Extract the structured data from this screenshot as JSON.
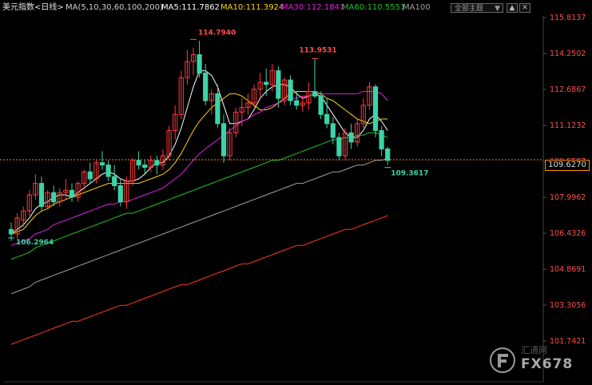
{
  "header": {
    "symbol_label": "美元指数<日线>",
    "ma_params": "MA(5,10,30,60,100,200)",
    "ma5": "MA5:111.7862",
    "ma10": "MA10:111.3924",
    "ma30": "MA30:112.1841",
    "ma60": "MA60:110.5551",
    "ma100": "MA100",
    "dropdown_label": "全部主题",
    "dropdown_arrow": "▼",
    "tool_up": "▲",
    "tool_close": "✕"
  },
  "price_axis": {
    "ticks": [
      "115.8137",
      "114.2502",
      "112.6867",
      "111.1232",
      "109.5597",
      "107.9962",
      "106.4326",
      "104.8691",
      "103.3056",
      "101.7421"
    ],
    "current_tag": "109.6270"
  },
  "annotations": {
    "high": "114.7940",
    "high2": "113.9531",
    "low": "106.2964",
    "last_low": "109.3617"
  },
  "watermark": {
    "brand": "汇通网",
    "code": "FX678"
  },
  "colors": {
    "up": "#ff3b3b",
    "down": "#3cd3a8",
    "ma5": "#ffffff",
    "ma10": "#ffd400",
    "ma30": "#e020e0",
    "ma60": "#22c322",
    "ma100": "#a0a0a0",
    "ma200": "#ff3a1a",
    "axis_text": "#ff4d4d",
    "price_line": "#ff8c00"
  },
  "chart_data": {
    "type": "candlestick",
    "title": "美元指数<日线>",
    "ylim": [
      101.7421,
      115.8137
    ],
    "current_price": 109.627,
    "candles": [
      [
        106.6,
        106.9,
        106.1,
        106.4
      ],
      [
        106.4,
        107.3,
        106.2,
        107.1
      ],
      [
        107.0,
        107.6,
        106.7,
        107.4
      ],
      [
        107.4,
        108.3,
        107.2,
        108.1
      ],
      [
        108.1,
        109.0,
        107.9,
        108.6
      ],
      [
        108.6,
        108.9,
        107.4,
        107.6
      ],
      [
        107.6,
        108.3,
        107.5,
        108.2
      ],
      [
        108.2,
        108.5,
        107.6,
        107.8
      ],
      [
        107.8,
        108.4,
        107.6,
        108.2
      ],
      [
        108.2,
        108.8,
        107.9,
        108.3
      ],
      [
        108.3,
        108.6,
        107.8,
        108.0
      ],
      [
        108.0,
        108.7,
        107.8,
        108.6
      ],
      [
        108.6,
        109.2,
        108.3,
        109.1
      ],
      [
        109.1,
        109.5,
        108.6,
        108.8
      ],
      [
        108.8,
        109.6,
        108.6,
        109.5
      ],
      [
        109.5,
        110.0,
        109.2,
        109.4
      ],
      [
        109.4,
        109.6,
        108.7,
        108.9
      ],
      [
        108.9,
        109.4,
        108.3,
        108.5
      ],
      [
        108.5,
        108.8,
        107.6,
        107.8
      ],
      [
        107.8,
        108.9,
        107.5,
        108.7
      ],
      [
        108.7,
        109.7,
        108.5,
        109.6
      ],
      [
        109.6,
        110.0,
        109.2,
        109.4
      ],
      [
        109.4,
        109.6,
        109.0,
        109.3
      ],
      [
        109.3,
        109.8,
        109.1,
        109.6
      ],
      [
        109.6,
        109.8,
        109.0,
        109.4
      ],
      [
        109.4,
        110.1,
        109.2,
        109.8
      ],
      [
        109.8,
        111.1,
        109.6,
        110.9
      ],
      [
        110.9,
        112.0,
        110.5,
        111.6
      ],
      [
        111.6,
        113.5,
        111.4,
        113.2
      ],
      [
        113.2,
        114.4,
        112.9,
        113.9
      ],
      [
        113.9,
        114.5,
        113.3,
        114.2
      ],
      [
        114.2,
        114.8,
        113.2,
        113.4
      ],
      [
        113.4,
        113.8,
        112.0,
        112.2
      ],
      [
        112.2,
        112.7,
        111.6,
        112.5
      ],
      [
        112.5,
        112.9,
        111.0,
        111.2
      ],
      [
        111.2,
        111.6,
        109.5,
        109.8
      ],
      [
        109.8,
        111.0,
        109.6,
        110.8
      ],
      [
        110.8,
        111.9,
        110.6,
        111.7
      ],
      [
        111.7,
        112.3,
        111.1,
        111.9
      ],
      [
        111.9,
        112.5,
        111.6,
        112.1
      ],
      [
        112.1,
        112.9,
        111.9,
        112.7
      ],
      [
        112.7,
        113.4,
        112.3,
        113.0
      ],
      [
        113.0,
        113.6,
        112.4,
        112.9
      ],
      [
        112.9,
        113.8,
        112.6,
        113.5
      ],
      [
        113.5,
        113.7,
        111.9,
        112.3
      ],
      [
        112.3,
        113.2,
        112.0,
        113.1
      ],
      [
        113.1,
        113.3,
        112.0,
        112.2
      ],
      [
        112.2,
        112.6,
        111.8,
        112.0
      ],
      [
        112.0,
        112.4,
        111.7,
        112.1
      ],
      [
        112.1,
        113.0,
        111.8,
        112.6
      ],
      [
        112.6,
        114.0,
        112.3,
        112.4
      ],
      [
        112.4,
        112.6,
        111.4,
        111.6
      ],
      [
        111.6,
        112.3,
        111.0,
        111.2
      ],
      [
        111.2,
        111.5,
        110.3,
        110.6
      ],
      [
        110.6,
        110.8,
        109.6,
        109.8
      ],
      [
        109.8,
        111.0,
        109.6,
        110.8
      ],
      [
        110.8,
        111.2,
        110.1,
        110.4
      ],
      [
        110.4,
        111.4,
        110.2,
        111.2
      ],
      [
        111.2,
        112.3,
        111.0,
        112.0
      ],
      [
        112.0,
        113.0,
        111.8,
        112.8
      ],
      [
        112.8,
        112.9,
        110.6,
        110.9
      ],
      [
        110.9,
        111.1,
        109.8,
        110.1
      ],
      [
        110.1,
        110.2,
        109.4,
        109.6
      ]
    ],
    "high_label": {
      "index": 30,
      "value": 114.794
    },
    "high2_label": {
      "index": 50,
      "value": 113.9531
    },
    "low_label": {
      "index": 0,
      "value": 106.2964
    },
    "last_low_label": {
      "index": 62,
      "value": 109.3617
    },
    "series": [
      {
        "name": "MA5",
        "values": [
          106.4,
          106.6,
          106.8,
          107.1,
          107.5,
          107.7,
          107.8,
          108.0,
          108.1,
          108.1,
          108.0,
          108.2,
          108.4,
          108.6,
          108.8,
          109.0,
          109.1,
          109.0,
          108.8,
          108.7,
          108.7,
          108.8,
          109.0,
          109.3,
          109.5,
          109.5,
          109.8,
          110.3,
          111.0,
          111.9,
          112.8,
          113.5,
          113.5,
          113.3,
          112.8,
          112.0,
          111.2,
          111.2,
          111.3,
          111.4,
          111.8,
          112.3,
          112.6,
          112.8,
          112.9,
          112.9,
          112.8,
          112.5,
          112.3,
          112.4,
          112.5,
          112.4,
          112.0,
          111.6,
          111.2,
          110.8,
          110.6,
          110.6,
          110.9,
          111.4,
          111.6,
          111.3,
          110.9
        ]
      },
      {
        "name": "MA10",
        "values": [
          106.4,
          106.5,
          106.6,
          106.9,
          107.2,
          107.4,
          107.5,
          107.7,
          107.8,
          107.9,
          108.0,
          108.1,
          108.2,
          108.3,
          108.4,
          108.5,
          108.6,
          108.6,
          108.6,
          108.6,
          108.6,
          108.6,
          108.7,
          108.8,
          108.9,
          109.0,
          109.2,
          109.5,
          109.9,
          110.4,
          110.9,
          111.3,
          111.6,
          111.9,
          112.1,
          112.3,
          112.5,
          112.5,
          112.4,
          112.2,
          112.0,
          111.8,
          111.8,
          111.9,
          112.1,
          112.3,
          112.5,
          112.6,
          112.6,
          112.6,
          112.6,
          112.5,
          112.3,
          112.2,
          112.0,
          111.8,
          111.6,
          111.4,
          111.3,
          111.2,
          111.3,
          111.4,
          111.4
        ]
      },
      {
        "name": "MA30",
        "values": [
          105.9,
          106.0,
          106.1,
          106.2,
          106.4,
          106.5,
          106.6,
          106.8,
          106.9,
          107.0,
          107.1,
          107.2,
          107.3,
          107.4,
          107.5,
          107.6,
          107.7,
          107.7,
          107.8,
          107.8,
          107.9,
          108.0,
          108.1,
          108.2,
          108.3,
          108.4,
          108.6,
          108.8,
          109.0,
          109.3,
          109.6,
          109.9,
          110.1,
          110.3,
          110.5,
          110.7,
          110.9,
          111.1,
          111.3,
          111.4,
          111.6,
          111.7,
          111.9,
          112.0,
          112.1,
          112.2,
          112.3,
          112.3,
          112.4,
          112.4,
          112.5,
          112.5,
          112.5,
          112.5,
          112.5,
          112.5,
          112.5,
          112.5,
          112.6,
          112.6,
          112.6,
          112.5,
          112.2
        ]
      },
      {
        "name": "MA60",
        "values": [
          105.3,
          105.4,
          105.5,
          105.6,
          105.8,
          105.9,
          106.0,
          106.1,
          106.2,
          106.3,
          106.4,
          106.5,
          106.6,
          106.7,
          106.8,
          106.9,
          107.0,
          107.1,
          107.2,
          107.3,
          107.3,
          107.4,
          107.5,
          107.6,
          107.7,
          107.8,
          107.9,
          108.0,
          108.1,
          108.2,
          108.3,
          108.4,
          108.5,
          108.6,
          108.7,
          108.8,
          108.9,
          109.0,
          109.1,
          109.2,
          109.3,
          109.4,
          109.5,
          109.6,
          109.6,
          109.7,
          109.8,
          109.9,
          110.0,
          110.1,
          110.2,
          110.3,
          110.4,
          110.5,
          110.5,
          110.6,
          110.6,
          110.7,
          110.7,
          110.8,
          110.8,
          110.7,
          110.6
        ]
      },
      {
        "name": "MA100",
        "values": [
          103.8,
          103.9,
          104.0,
          104.1,
          104.3,
          104.4,
          104.5,
          104.6,
          104.7,
          104.8,
          104.9,
          105.0,
          105.1,
          105.2,
          105.3,
          105.4,
          105.5,
          105.6,
          105.7,
          105.8,
          105.9,
          106.0,
          106.1,
          106.2,
          106.3,
          106.4,
          106.5,
          106.6,
          106.7,
          106.8,
          106.9,
          107.0,
          107.1,
          107.2,
          107.3,
          107.4,
          107.5,
          107.6,
          107.7,
          107.8,
          107.9,
          108.0,
          108.1,
          108.2,
          108.3,
          108.4,
          108.5,
          108.6,
          108.6,
          108.7,
          108.8,
          108.9,
          109.0,
          109.1,
          109.1,
          109.2,
          109.3,
          109.4,
          109.4,
          109.5,
          109.6,
          109.6,
          109.7
        ]
      },
      {
        "name": "MA200",
        "values": [
          101.6,
          101.7,
          101.8,
          101.9,
          102.0,
          102.1,
          102.2,
          102.3,
          102.4,
          102.5,
          102.6,
          102.6,
          102.7,
          102.8,
          102.9,
          103.0,
          103.1,
          103.2,
          103.3,
          103.3,
          103.4,
          103.5,
          103.6,
          103.7,
          103.8,
          103.9,
          104.0,
          104.1,
          104.2,
          104.2,
          104.3,
          104.4,
          104.5,
          104.6,
          104.7,
          104.8,
          104.9,
          105.0,
          105.1,
          105.1,
          105.2,
          105.3,
          105.4,
          105.5,
          105.6,
          105.7,
          105.8,
          105.9,
          105.9,
          106.0,
          106.1,
          106.2,
          106.3,
          106.4,
          106.5,
          106.6,
          106.6,
          106.7,
          106.8,
          106.9,
          107.0,
          107.1,
          107.2
        ]
      }
    ]
  }
}
